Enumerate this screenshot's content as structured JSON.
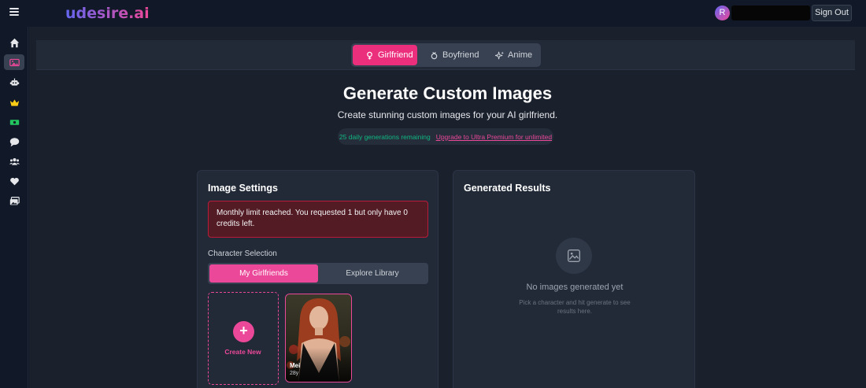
{
  "header": {
    "logo": "udesire.ai",
    "avatar_initial": "R",
    "sign_out": "Sign Out"
  },
  "sidebar": {
    "items": [
      {
        "icon": "home-icon",
        "active": false
      },
      {
        "icon": "image-icon",
        "active": true
      },
      {
        "icon": "robot-icon",
        "active": false
      },
      {
        "icon": "crown-icon",
        "active": false
      },
      {
        "icon": "money-icon",
        "active": false
      },
      {
        "icon": "chat-icon",
        "active": false
      },
      {
        "icon": "users-icon",
        "active": false
      },
      {
        "icon": "heart-icon",
        "active": false
      },
      {
        "icon": "gallery-icon",
        "active": false
      }
    ]
  },
  "type_tabs": [
    {
      "label": "Girlfriend",
      "icon": "female-icon",
      "active": true
    },
    {
      "label": "Boyfriend",
      "icon": "male-icon",
      "active": false
    },
    {
      "label": "Anime",
      "icon": "sparkles-icon",
      "active": false
    }
  ],
  "hero": {
    "title": "Generate Custom Images",
    "subtitle": "Create stunning custom images for your AI girlfriend.",
    "remaining": "25 daily generations remaining",
    "upgrade_link": "Upgrade to Ultra Premium for unlimited"
  },
  "settings": {
    "title": "Image Settings",
    "alert": "Monthly limit reached. You requested 1 but only have 0 credits left.",
    "character_label": "Character Selection",
    "toggle": [
      "My Girlfriends",
      "Explore Library"
    ],
    "create_new": "Create New",
    "character": {
      "name": "Mei",
      "age": "28y"
    }
  },
  "results": {
    "title": "Generated Results",
    "empty_title": "No images generated yet",
    "empty_sub": "Pick a character and hit generate to see results here."
  },
  "colors": {
    "accent": "#ec4899",
    "success": "#10b981",
    "background": "#1a202c"
  }
}
